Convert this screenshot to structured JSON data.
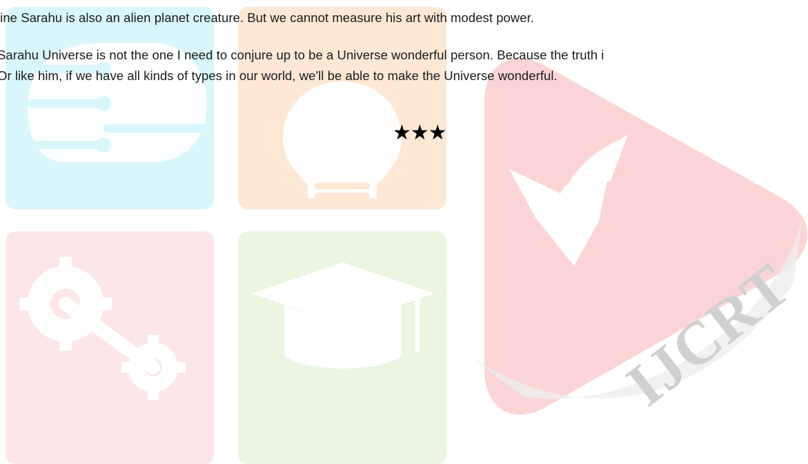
{
  "document": {
    "lines": [
      "line Sarahu is also an alien planet creature. But we cannot measure his art with modest power.",
      "Sarahu Universe is not the one I need to conjure up to be a Universe wonderful person. Because the truth i",
      "Or like him, if we have all kinds of types in our world, we'll be able to make the Universe wonderful."
    ],
    "separator": "★★★"
  },
  "watermark": {
    "logo_text": "IJCRT",
    "icons": [
      "brain-chip-icon",
      "light-bulb-icon",
      "open-book-icon",
      "gears-icon",
      "graduation-cap-icon"
    ],
    "colors": {
      "cyan": "#d9f6fb",
      "orange": "#fde8d6",
      "red": "#fbd5d5",
      "pink": "#fde6e8",
      "green": "#eaf6e1"
    }
  }
}
